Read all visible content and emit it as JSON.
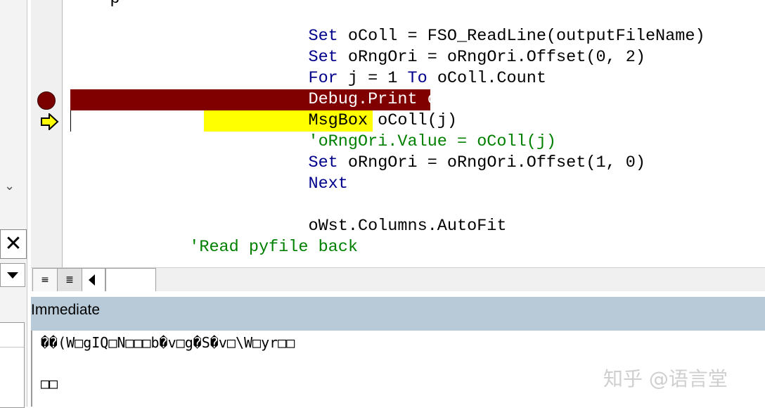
{
  "code": {
    "line_0": "    p",
    "line_1": "        Set oColl = FSO_ReadLine(outputFileName)",
    "line_2": "        Set oRngOri = oRngOri.Offset(0, 2)",
    "line_3": "        For j = 1 To oColl.Count",
    "bp_kw": "Debug.Print",
    "bp_rest": " oColl(j)",
    "exec_text": "MsgBox oColl(j)",
    "comment_line": "'oRngOri.Value = oColl(j)",
    "line_7": "        Set oRngOri = oRngOri.Offset(1, 0)",
    "line_8": "Next",
    "line_10": "oWst.Columns.AutoFit",
    "line_11": "'Read pyfile back"
  },
  "keywords": {
    "set": "Set",
    "for": "For",
    "to": "To",
    "next": "Next"
  },
  "view_buttons": {
    "procedure_view": "≡",
    "full_module_view": "≣"
  },
  "immediate": {
    "title": "Immediate",
    "output_line_1": "��(W□gIQ□N□□□b�v□g�S�v□\\W□yr□□",
    "output_line_2": "□□"
  },
  "watermark": "知乎 @语言堂",
  "colors": {
    "breakpoint": "#800000",
    "execution_highlight": "#ffff00",
    "keyword": "#00008b",
    "comment": "#008000",
    "immediate_title_bar": "#b8cad8"
  }
}
